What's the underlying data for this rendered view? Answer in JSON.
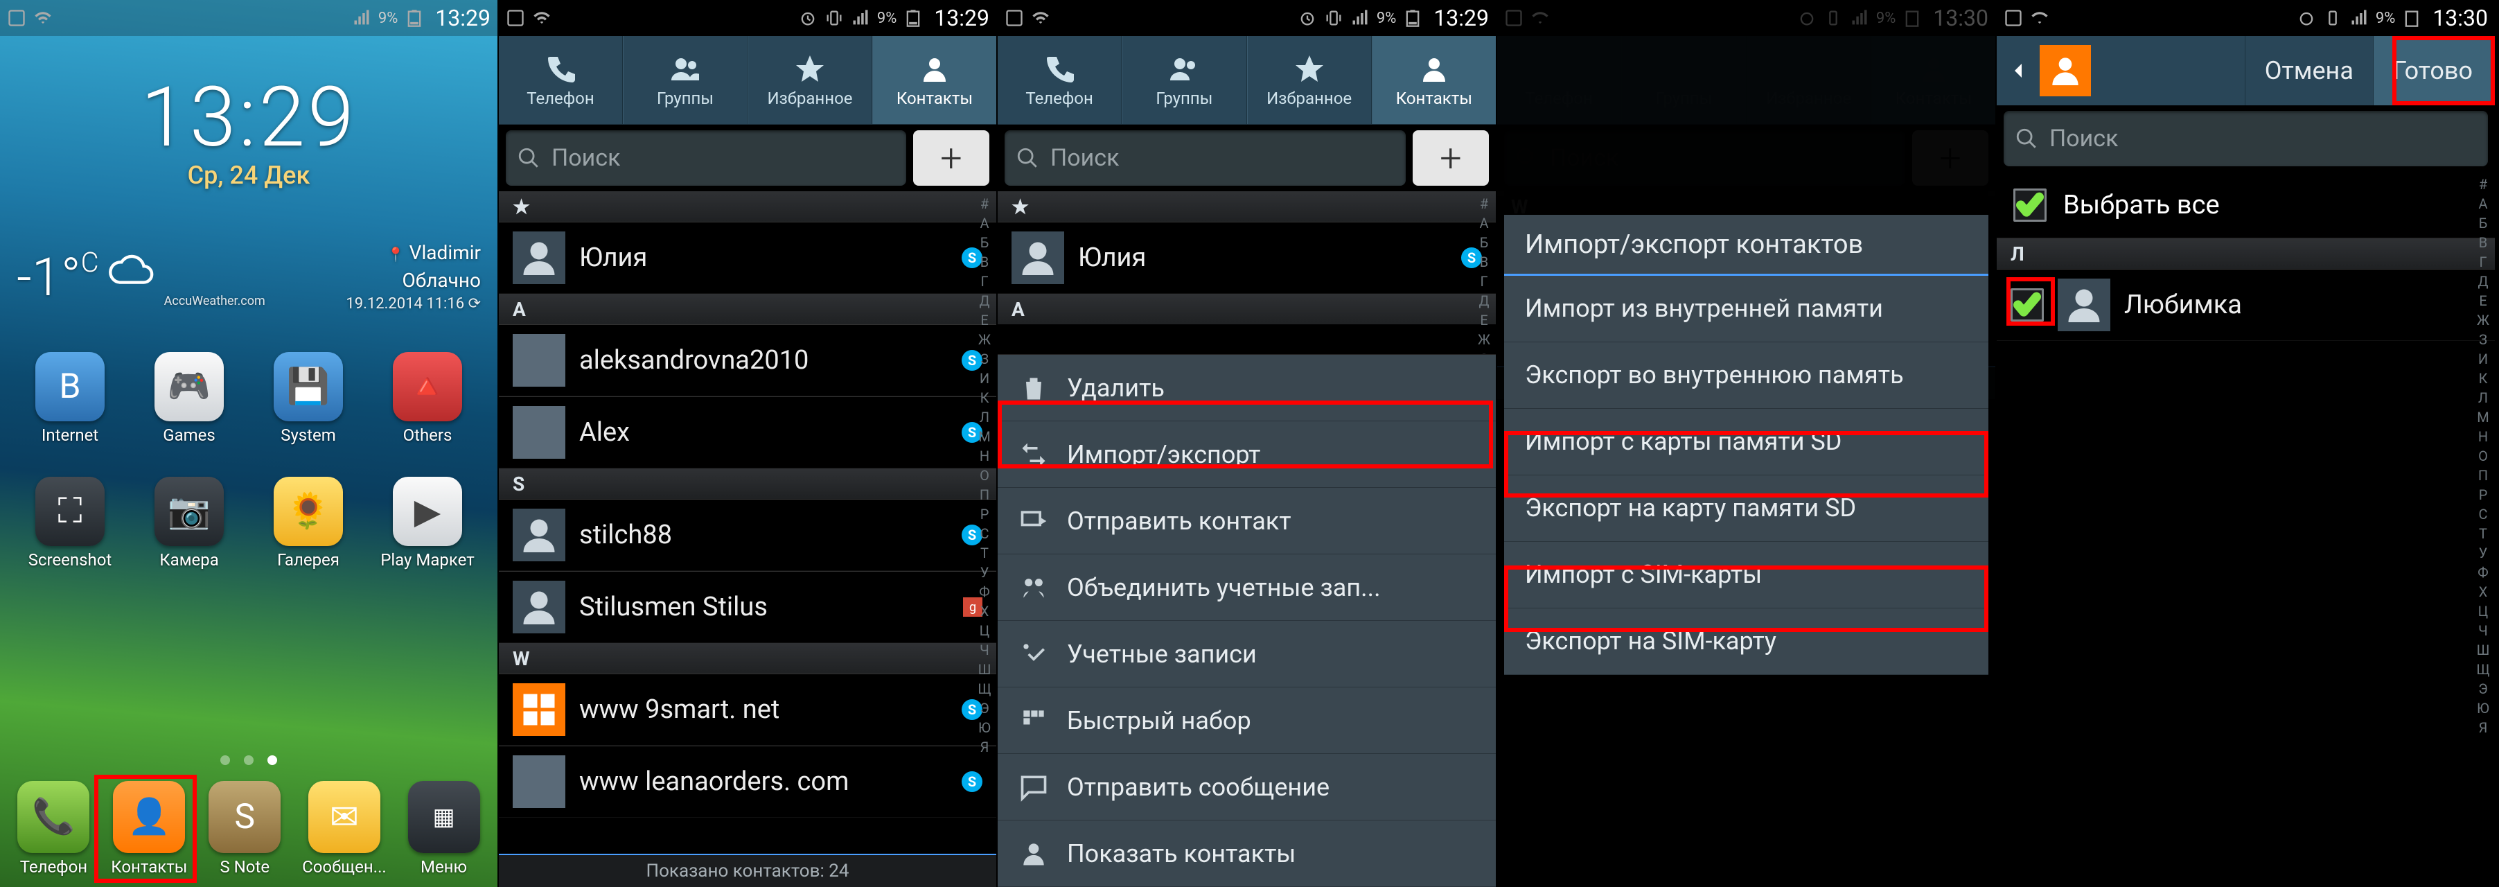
{
  "status": {
    "time1": "13:29",
    "time2": "13:30",
    "battery": "9%"
  },
  "home": {
    "clock": "13:29",
    "date": "Ср, 24 Дек",
    "temp": "-1°",
    "tempUnit": "C",
    "location": "Vladimir",
    "condition": "Облачно",
    "updated": "19.12.2014 11:16",
    "provider": "AccuWeather.com",
    "apps_row1": [
      {
        "label": "Internet"
      },
      {
        "label": "Games"
      },
      {
        "label": "System"
      },
      {
        "label": "Others"
      }
    ],
    "apps_row2": [
      {
        "label": "Screenshot"
      },
      {
        "label": "Камера"
      },
      {
        "label": "Галерея"
      },
      {
        "label": "Play Маркет"
      }
    ],
    "dock": [
      {
        "label": "Телефон"
      },
      {
        "label": "Контакты"
      },
      {
        "label": "S Note"
      },
      {
        "label": "Сообщен..."
      },
      {
        "label": "Меню"
      }
    ]
  },
  "tabs": {
    "phone": "Телефон",
    "groups": "Группы",
    "fav": "Избранное",
    "contacts": "Контакты"
  },
  "search": {
    "placeholder": "Поиск"
  },
  "contacts": {
    "star_header": "★",
    "star": [
      {
        "name": "Юлия"
      }
    ],
    "a_header": "A",
    "a": [
      {
        "name": "aleksandrovna2010"
      },
      {
        "name": "Alex"
      }
    ],
    "s_header": "S",
    "s": [
      {
        "name": "stilch88"
      },
      {
        "name": "Stilusmen Stilus"
      }
    ],
    "w_header": "W",
    "w": [
      {
        "name": "www 9smart. net"
      },
      {
        "name": "www leanaorders. com"
      }
    ],
    "footer": "Показано контактов: 24"
  },
  "ctxmenu": {
    "delete": "Удалить",
    "importexport": "Импорт/экспорт",
    "send": "Отправить контакт",
    "merge": "Объединить учетные зап...",
    "accounts": "Учетные записи",
    "speeddial": "Быстрый набор",
    "sendmsg": "Отправить сообщение",
    "show": "Показать контакты"
  },
  "dialog": {
    "title": "Импорт/экспорт контактов",
    "items": {
      "imp_internal": "Импорт из внутренней памяти",
      "exp_internal": "Экспорт во внутреннюю память",
      "imp_sd": "Импорт с карты памяти SD",
      "exp_sd": "Экспорт на карту памяти SD",
      "imp_sim": "Импорт с SIM-карты",
      "exp_sim": "Экспорт на SIM-карту"
    }
  },
  "selection": {
    "cancel": "Отмена",
    "done": "Готово",
    "select_all": "Выбрать все",
    "section": "Л",
    "items": [
      {
        "name": "Любимка"
      }
    ]
  },
  "az": "#АБВГДЕЖЗИКЛМНОПРСТУФХЦЧШЩЭЮЯ"
}
